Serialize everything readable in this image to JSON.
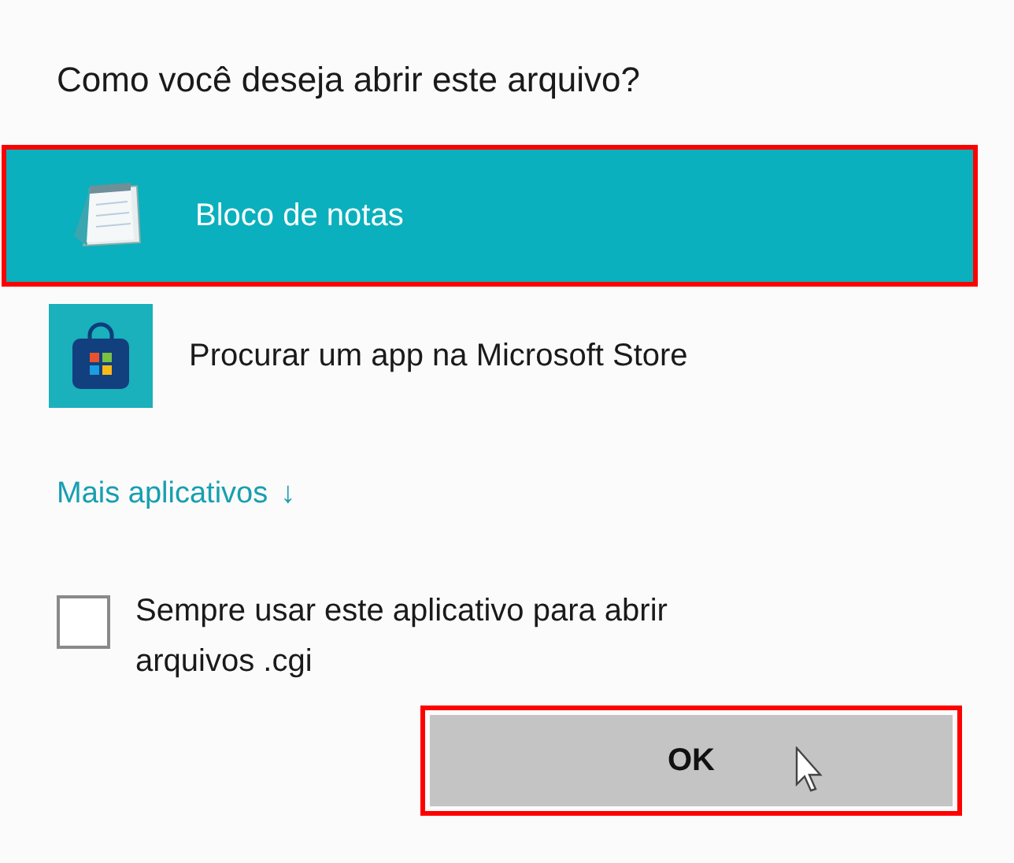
{
  "title": "Como você deseja abrir este arquivo?",
  "apps": [
    {
      "kind": "notepad",
      "name": "Bloco de notas",
      "selected": true,
      "annotated": true
    },
    {
      "kind": "store",
      "name": "Procurar um app na Microsoft Store",
      "selected": false,
      "annotated": false
    }
  ],
  "more_apps": {
    "label": "Mais aplicativos",
    "arrow": "↓"
  },
  "always_use": {
    "label": "Sempre usar este aplicativo para abrir arquivos .cgi",
    "checked": false
  },
  "ok_button": {
    "label": "OK",
    "annotated": true
  }
}
